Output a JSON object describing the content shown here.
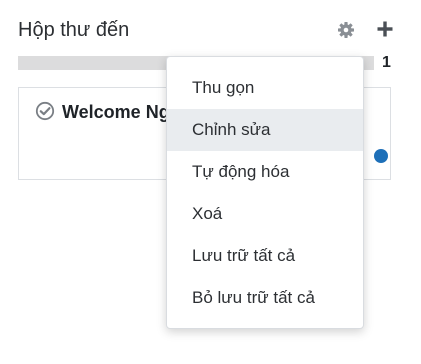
{
  "column": {
    "title": "Hộp thư đến",
    "count": "1",
    "progress_fraction": 0.0
  },
  "card": {
    "title": "Welcome Ng"
  },
  "icons": {
    "gear": "gear-icon",
    "plus": "plus-icon",
    "check": "check-circle-icon"
  },
  "colors": {
    "progress_track": "#dcdcdd",
    "active_item_bg": "#e9ecef",
    "avatar": "#1d6fb8"
  },
  "menu": {
    "items": [
      {
        "label": "Thu gọn"
      },
      {
        "label": "Chỉnh sửa",
        "active": true
      },
      {
        "label": "Tự động hóa"
      },
      {
        "label": "Xoá"
      },
      {
        "label": "Lưu trữ tất cả"
      },
      {
        "label": "Bỏ lưu trữ tất cả"
      }
    ]
  }
}
